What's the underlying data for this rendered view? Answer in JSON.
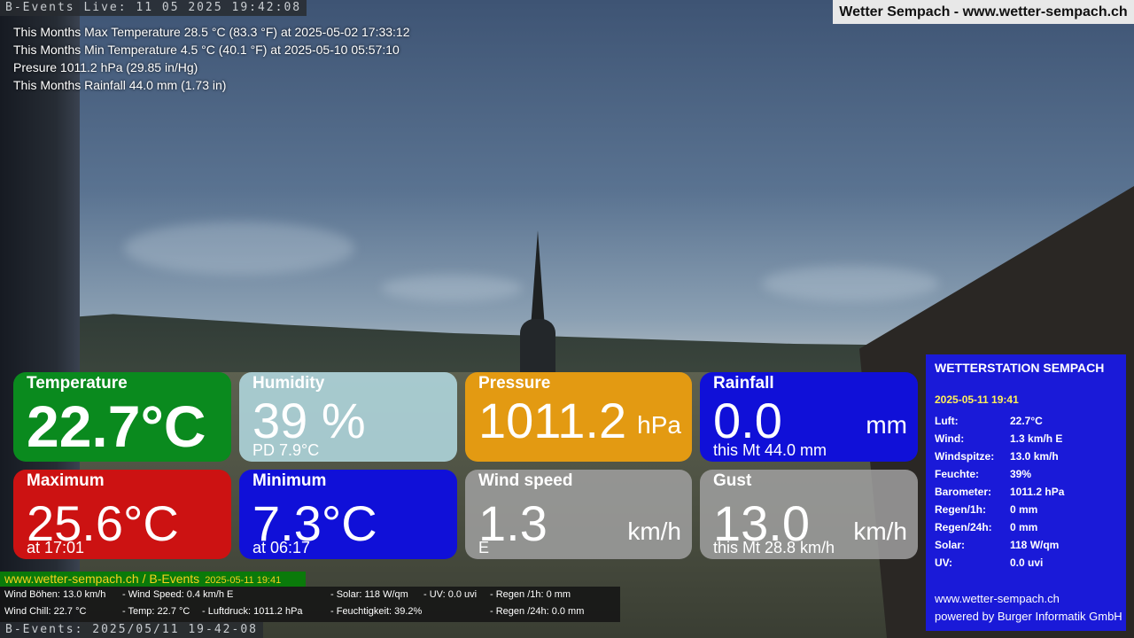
{
  "osd": {
    "top": "B-Events Live: 11 05 2025 19:42:08",
    "bottom": "B-Events: 2025/05/11 19-42-08"
  },
  "site_title": "Wetter Sempach - www.wetter-sempach.ch",
  "month_stats": [
    "This Months Max Temperature 28.5 °C (83.3 °F) at 2025-05-02 17:33:12",
    "This Months Min Temperature 4.5 °C (40.1 °F) at 2025-05-10 05:57:10",
    "Presure 1011.2 hPa (29.85 in/Hg)",
    "This Months Rainfall 44.0 mm (1.73 in)"
  ],
  "tiles": {
    "temperature": {
      "label": "Temperature",
      "value": "22.7°C"
    },
    "humidity": {
      "label": "Humidity",
      "value": "39 %",
      "sub": "PD 7.9°C"
    },
    "pressure": {
      "label": "Pressure",
      "value": "1011.2",
      "unit": "hPa"
    },
    "rainfall": {
      "label": "Rainfall",
      "value": "0.0",
      "unit": "mm",
      "sub": "this Mt 44.0 mm"
    },
    "maximum": {
      "label": "Maximum",
      "value": "25.6°C",
      "sub": "at 17:01"
    },
    "minimum": {
      "label": "Minimum",
      "value": "7.3°C",
      "sub": "at 06:17"
    },
    "wind": {
      "label": "Wind speed",
      "value": "1.3",
      "unit": "km/h",
      "sub": "E"
    },
    "gust": {
      "label": "Gust",
      "value": "13.0",
      "unit": "km/h",
      "sub": "this Mt 28.8 km/h"
    }
  },
  "station": {
    "title": "WETTERSTATION SEMPACH",
    "date": "2025-05-11 19:41",
    "rows": [
      {
        "k": "Luft:",
        "v": "22.7°C"
      },
      {
        "k": "Wind:",
        "v": "1.3 km/h  E"
      },
      {
        "k": "Windspitze:",
        "v": "13.0 km/h"
      },
      {
        "k": "Feuchte:",
        "v": "39%"
      },
      {
        "k": "Barometer:",
        "v": "1011.2 hPa"
      },
      {
        "k": "Regen/1h:",
        "v": "0 mm"
      },
      {
        "k": "Regen/24h:",
        "v": "0 mm"
      },
      {
        "k": "Solar:",
        "v": "118 W/qm"
      },
      {
        "k": "UV:",
        "v": "0.0 uvi"
      }
    ],
    "footer_url": "www.wetter-sempach.ch",
    "footer_powered": "powered by Burger Informatik GmbH"
  },
  "ticker": {
    "head": "www.wetter-sempach.ch / B-Events",
    "head_date": "2025-05-11 19:41",
    "row1": {
      "a": "Wind Böhen: 13.0 km/h",
      "b": "- Wind Speed: 0.4 km/h E",
      "c": "- Solar: 118 W/qm",
      "d": "- UV: 0.0 uvi",
      "e": "- Regen /1h:   0 mm"
    },
    "row2": {
      "a": "Wind Chill: 22.7 °C",
      "b": "- Temp: 22.7 °C",
      "b2": "- Luftdruck: 1011.2 hPa",
      "c": "- Feuchtigkeit: 39.2%",
      "e": "- Regen /24h: 0.0 mm"
    }
  }
}
